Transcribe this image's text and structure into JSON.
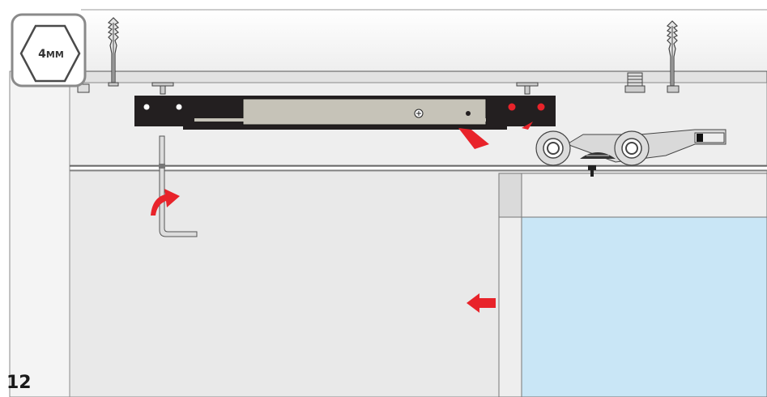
{
  "tool": {
    "size": "4",
    "unit": "MM",
    "icon": "hex-key-icon"
  },
  "step": {
    "number": "12"
  },
  "colors": {
    "accent_red": "#e8232a",
    "glass": "#c9e6f6",
    "panel": "#e9e9e9",
    "damper_body": "#231f20",
    "damper_slide": "#c6c3b8",
    "roller": "#d8d8d8",
    "outline": "#4a4a4a"
  },
  "icons": [
    "hex-key-badge-icon",
    "wall-anchor-icon",
    "allen-key-icon",
    "rotate-arrow-icon",
    "push-left-arrow-icon",
    "soft-close-damper-icon",
    "roller-carriage-icon"
  ]
}
